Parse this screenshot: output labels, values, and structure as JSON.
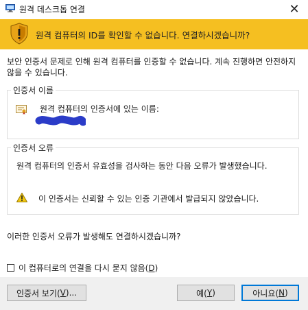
{
  "window": {
    "title": "원격 데스크톱 연결",
    "close_glyph": "✕"
  },
  "banner": {
    "text": "원격 컴퓨터의 ID를 확인할 수 없습니다. 연결하시겠습니까?",
    "color": "#f5bf21"
  },
  "body": {
    "description": "보안 인증서 문제로 인해 원격 컴퓨터를 인증할 수 없습니다. 계속 진행하면 안전하지 않을 수 있습니다."
  },
  "cert_name_group": {
    "title": "인증서 이름",
    "label": "원격 컴퓨터의 인증서에 있는 이름:"
  },
  "cert_error_group": {
    "title": "인증서 오류",
    "description": "원격 컴퓨터의 인증서 유효성을 검사하는 동안 다음 오류가 발생했습니다.",
    "warning": "이 인증서는 신뢰할 수 있는 인증 기관에서 발급되지 않았습니다."
  },
  "question": "이러한 인증서 오류가 발생해도 연결하시겠습니까?",
  "checkbox": {
    "label_prefix": "이 컴퓨터로의 연결을 다시 묻지 않음(",
    "hotkey": "D",
    "label_suffix": ")",
    "checked": false
  },
  "buttons": {
    "view_prefix": "인증서 보기(",
    "view_hotkey": "V",
    "view_suffix": ")...",
    "yes_prefix": "예(",
    "yes_hotkey": "Y",
    "yes_suffix": ")",
    "no_prefix": "아니요(",
    "no_hotkey": "N",
    "no_suffix": ")"
  },
  "icons": {
    "app": "remote-desktop-icon",
    "banner": "shield-warning-icon",
    "cert": "certificate-icon",
    "warning": "warning-triangle-icon"
  }
}
